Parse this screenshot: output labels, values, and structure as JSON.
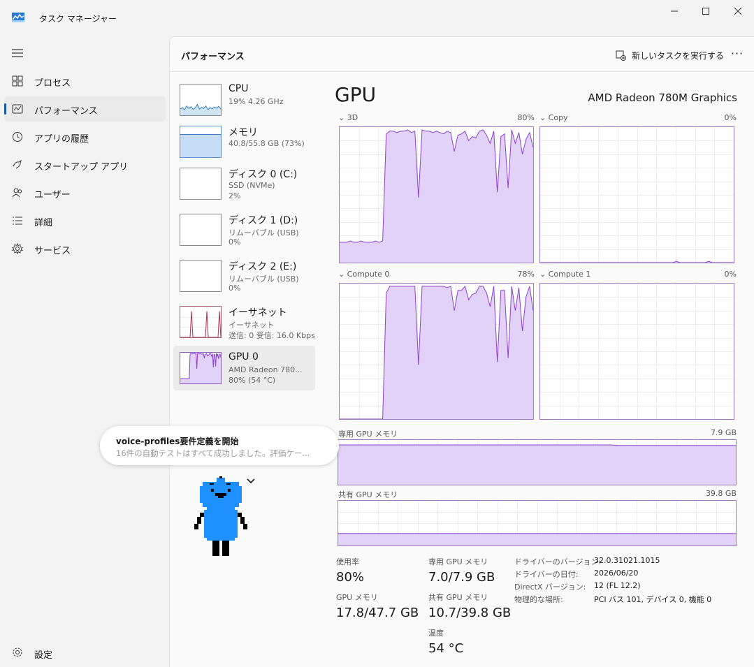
{
  "window": {
    "title": "タスク マネージャー"
  },
  "sidebar": {
    "items": [
      {
        "label": "プロセス",
        "icon": "grid-icon"
      },
      {
        "label": "パフォーマンス",
        "icon": "performance-icon",
        "active": true
      },
      {
        "label": "アプリの履歴",
        "icon": "history-icon"
      },
      {
        "label": "スタートアップ アプリ",
        "icon": "startup-icon"
      },
      {
        "label": "ユーザー",
        "icon": "users-icon"
      },
      {
        "label": "詳細",
        "icon": "list-icon"
      },
      {
        "label": "サービス",
        "icon": "services-icon"
      }
    ],
    "settings_label": "設定"
  },
  "header": {
    "title": "パフォーマンス",
    "run_task_label": "新しいタスクを実行する",
    "more_label": "···"
  },
  "devices": [
    {
      "name": "CPU",
      "line1": "19%  4.26 GHz",
      "line2": ""
    },
    {
      "name": "メモリ",
      "line1": "40.8/55.8 GB (73%)",
      "line2": ""
    },
    {
      "name": "ディスク 0 (C:)",
      "line1": "SSD (NVMe)",
      "line2": "2%"
    },
    {
      "name": "ディスク 1 (D:)",
      "line1": "リムーバブル (USB)",
      "line2": "0%"
    },
    {
      "name": "ディスク 2 (E:)",
      "line1": "リムーバブル (USB)",
      "line2": "0%"
    },
    {
      "name": "イーサネット",
      "line1": "イーサネット",
      "line2": "送信: 0 受信: 16.0 Kbps"
    },
    {
      "name": "GPU 0",
      "line1": "AMD Radeon 780...",
      "line2": "80%  (54 °C)",
      "active": true
    }
  ],
  "gpu": {
    "title": "GPU",
    "model": "AMD Radeon 780M Graphics",
    "engines": [
      {
        "label": "3D",
        "value": "80%"
      },
      {
        "label": "Copy",
        "value": "0%"
      },
      {
        "label": "Compute 0",
        "value": "78%"
      },
      {
        "label": "Compute 1",
        "value": "0%"
      }
    ],
    "dedicated_label": "専用 GPU メモリ",
    "dedicated_max": "7.9 GB",
    "shared_label": "共有 GPU メモリ",
    "shared_max": "39.8 GB",
    "stats": {
      "usage_label": "使用率",
      "usage_val": "80%",
      "dedicated_label": "専用 GPU メモリ",
      "dedicated_val": "7.0/7.9 GB",
      "gpumem_label": "GPU メモリ",
      "gpumem_val": "17.8/47.7 GB",
      "shared_label": "共有 GPU メモリ",
      "shared_val": "10.7/39.8 GB",
      "temp_label": "温度",
      "temp_val": "54 °C"
    },
    "info": [
      {
        "label": "ドライバーのバージョン:",
        "value": "32.0.31021.1015"
      },
      {
        "label": "ドライバーの日付:",
        "value": "2026/06/20"
      },
      {
        "label": "DirectX バージョン:",
        "value": "12 (FL 12.2)"
      },
      {
        "label": "物理的な場所:",
        "value": "PCI バス 101, デバイス 0, 機能 0"
      }
    ]
  },
  "toast": {
    "title": "voice-profiles要件定義を開始",
    "body": "16件の自動テストはすべて成功しました。評価ケー..."
  },
  "colors": {
    "gpu_line": "#8a3fd0",
    "gpu_fill": "#e3d2f7",
    "accent": "#1a56b0"
  },
  "series": {
    "3d": [
      15,
      15,
      15,
      16,
      15,
      15,
      16,
      15,
      15,
      15,
      16,
      15,
      16,
      95,
      97,
      97,
      96,
      97,
      97,
      98,
      96,
      97,
      48,
      98,
      97,
      97,
      96,
      97,
      96,
      95,
      97,
      96,
      82,
      94,
      95,
      97,
      90,
      93,
      92,
      97,
      98,
      94,
      88,
      97,
      52,
      93,
      95,
      55,
      98,
      88,
      96,
      80,
      91,
      96,
      85
    ],
    "compute0": [
      0,
      0,
      0,
      0,
      0,
      0,
      0,
      0,
      0,
      0,
      0,
      0,
      0,
      93,
      98,
      98,
      98,
      98,
      98,
      98,
      98,
      98,
      40,
      98,
      98,
      98,
      98,
      98,
      98,
      98,
      97,
      98,
      80,
      95,
      95,
      98,
      88,
      92,
      93,
      98,
      98,
      93,
      83,
      98,
      42,
      95,
      95,
      45,
      98,
      80,
      97,
      65,
      90,
      98,
      80
    ],
    "copy": [
      0,
      0,
      0,
      0,
      0,
      0,
      0,
      0,
      0,
      0,
      0,
      0,
      0,
      0,
      0,
      0,
      0,
      0,
      0,
      0,
      0,
      0,
      0,
      0,
      0,
      0,
      0,
      0,
      0,
      0,
      0,
      0,
      0,
      0,
      0,
      0,
      0,
      0,
      1,
      0,
      0,
      0,
      0,
      0,
      0,
      0,
      0,
      1,
      0,
      0,
      0,
      0,
      0,
      0,
      0
    ],
    "dedicated": [
      89,
      89,
      89,
      89,
      89,
      89,
      89,
      89,
      89,
      89,
      89,
      89,
      89,
      89,
      89,
      89,
      89,
      89,
      89,
      89,
      89,
      89,
      89,
      89,
      89,
      89,
      89,
      89,
      89,
      89,
      89,
      89,
      89,
      89,
      89,
      89,
      89,
      89,
      88,
      88,
      88,
      88,
      88,
      88,
      88,
      88,
      88,
      88,
      88,
      88,
      88,
      88,
      88,
      88,
      88
    ],
    "shared": [
      27,
      27,
      27,
      27,
      27,
      27,
      27,
      27,
      27,
      27,
      27,
      27,
      27,
      27,
      27,
      27,
      27,
      27,
      27,
      27,
      27,
      27,
      27,
      27,
      27,
      27,
      27,
      27,
      27,
      27,
      27,
      27,
      27,
      27,
      27,
      27,
      27,
      27,
      27,
      27,
      27,
      27,
      27,
      27,
      27,
      27,
      27,
      27,
      27,
      27,
      27,
      27,
      27,
      27,
      27
    ],
    "cpu_thumb": [
      20,
      25,
      18,
      30,
      22,
      28,
      19,
      24,
      35,
      20,
      26,
      22,
      30,
      18,
      25,
      21,
      27,
      23,
      29,
      20
    ],
    "eth_thumb": [
      0,
      0,
      0,
      0,
      0,
      0,
      0,
      0,
      85,
      0,
      0,
      0,
      0,
      0,
      0,
      0,
      0,
      0,
      0,
      85,
      0,
      0,
      0,
      0,
      0,
      0,
      0,
      0,
      85,
      0
    ]
  }
}
